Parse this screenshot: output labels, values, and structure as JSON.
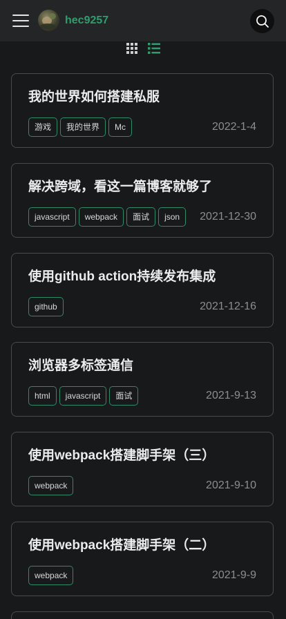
{
  "header": {
    "username": "hec9257",
    "menu_icon": "hamburger-menu-icon",
    "search_icon": "search-icon",
    "accent_color": "#2f9e6e"
  },
  "view_toggle": {
    "grid_icon": "grid-view-icon",
    "list_icon": "list-view-icon",
    "active": "list"
  },
  "posts": [
    {
      "title": "我的世界如何搭建私服",
      "tags": [
        "游戏",
        "我的世界",
        "Mc"
      ],
      "date": "2022-1-4"
    },
    {
      "title": "解决跨域，看这一篇博客就够了",
      "tags": [
        "javascript",
        "webpack",
        "面试",
        "json"
      ],
      "date": "2021-12-30"
    },
    {
      "title": "使用github action持续发布集成",
      "tags": [
        "github"
      ],
      "date": "2021-12-16"
    },
    {
      "title": "浏览器多标签通信",
      "tags": [
        "html",
        "javascript",
        "面试"
      ],
      "date": "2021-9-13"
    },
    {
      "title": "使用webpack搭建脚手架（三）",
      "tags": [
        "webpack"
      ],
      "date": "2021-9-10"
    },
    {
      "title": "使用webpack搭建脚手架（二）",
      "tags": [
        "webpack"
      ],
      "date": "2021-9-9"
    }
  ]
}
